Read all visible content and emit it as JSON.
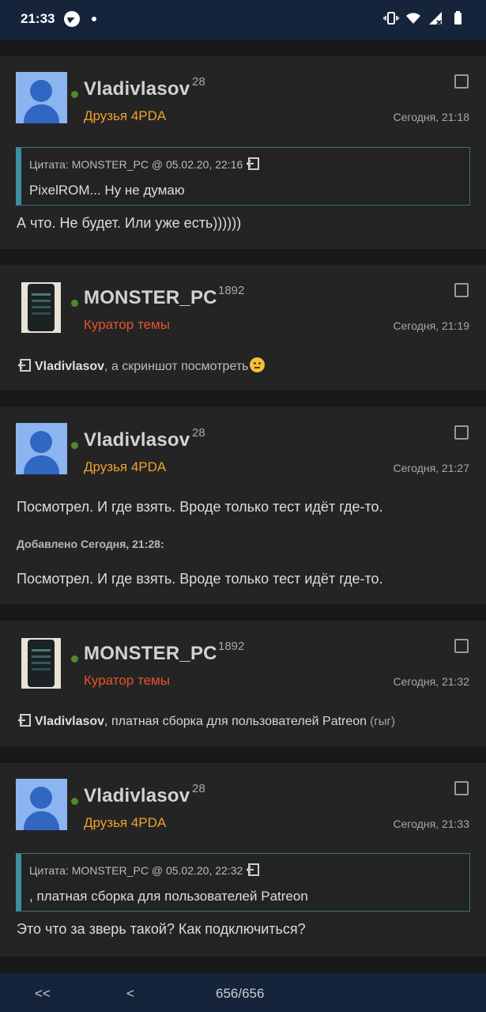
{
  "status_bar": {
    "time": "21:33",
    "icons": [
      "telegram-icon",
      "notification-dot-icon",
      "vibrate-icon",
      "wifi-icon",
      "signal-icon",
      "battery-icon"
    ]
  },
  "posts": [
    {
      "username": "Vladivlasov",
      "reputation": "28",
      "group": "Друзья 4PDA",
      "time": "Сегодня, 21:18",
      "quote": {
        "header": "Цитата: MONSTER_PC @ 05.02.20, 22:16",
        "text": "PixelROM... Ну не думаю"
      },
      "text": "А что. Не будет. Или уже есть))))))"
    },
    {
      "username": "MONSTER_PC",
      "reputation": "1892",
      "group": "Куратор темы",
      "time": "Сегодня, 21:19",
      "reply": {
        "nick": "Vladivlasov",
        "text": ", а скриншот посмотреть"
      }
    },
    {
      "username": "Vladivlasov",
      "reputation": "28",
      "group": "Друзья 4PDA",
      "time": "Сегодня, 21:27",
      "text": "Посмотрел. И где взять. Вроде только тест идёт где-то.",
      "added": "Добавлено Сегодня, 21:28:",
      "text2": "Посмотрел. И где взять. Вроде только тест идёт где-то."
    },
    {
      "username": "MONSTER_PC",
      "reputation": "1892",
      "group": "Куратор темы",
      "time": "Сегодня, 21:32",
      "reply": {
        "nick": "Vladivlasov",
        "text": ", платная сборка для пользователей Patreon",
        "small": " (гыг)"
      }
    },
    {
      "username": "Vladivlasov",
      "reputation": "28",
      "group": "Друзья 4PDA",
      "time": "Сегодня, 21:33",
      "quote": {
        "header": "Цитата: MONSTER_PC @ 05.02.20, 22:32",
        "text": ", платная сборка для пользователей Patreon"
      },
      "text": "Это что за зверь такой? Как подключиться?"
    }
  ],
  "bottom_nav": {
    "first_label": "<<",
    "prev_label": "<",
    "page_indicator": "656/656"
  },
  "colors": {
    "status_bar": "#15243a",
    "post_bg": "#242424",
    "friends_group": "#f0a12c",
    "curator_group": "#e2542d",
    "online": "#4f8a2e",
    "quote_border": "#3f8e9f"
  }
}
